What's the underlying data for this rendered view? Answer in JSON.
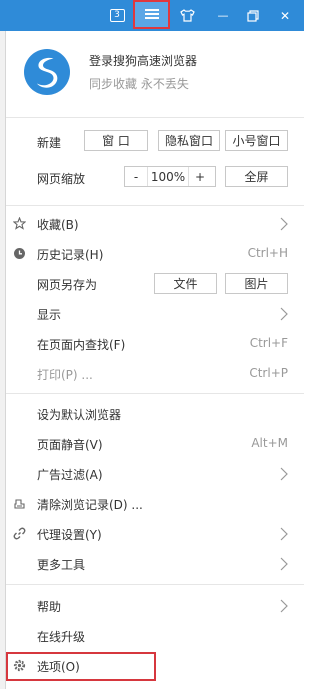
{
  "titlebar": {
    "tab_count": "3",
    "menu_icon": "hamburger-menu-icon",
    "skin_icon": "tshirt-skin-icon",
    "minimize_glyph": "—",
    "restore_icon": "restore-window-icon",
    "close_glyph": "✕",
    "bg_color": "#2f8bd8",
    "highlight_color": "#e0383e"
  },
  "profile": {
    "title": "登录搜狗高速浏览器",
    "subtitle": "同步收藏 永不丢失",
    "logo_icon": "sogou-logo-icon"
  },
  "new_row": {
    "label": "新建",
    "buttons": [
      "窗 口",
      "隐私窗口",
      "小号窗口"
    ]
  },
  "zoom_row": {
    "label": "网页缩放",
    "minus": "-",
    "value": "100%",
    "plus": "+",
    "fullscreen": "全屏"
  },
  "menu": {
    "favorites": {
      "label": "收藏(B)",
      "icon": "star-icon"
    },
    "history": {
      "label": "历史记录(H)",
      "shortcut": "Ctrl+H",
      "icon": "clock-icon"
    },
    "save_as": {
      "label": "网页另存为",
      "btn_file": "文件",
      "btn_image": "图片"
    },
    "display": {
      "label": "显示"
    },
    "find": {
      "label": "在页面内查找(F)",
      "shortcut": "Ctrl+F"
    },
    "print": {
      "label": "打印(P) ...",
      "shortcut": "Ctrl+P"
    },
    "set_default": {
      "label": "设为默认浏览器"
    },
    "mute": {
      "label": "页面静音(V)",
      "shortcut": "Alt+M"
    },
    "ad_filter": {
      "label": "广告过滤(A)"
    },
    "clear_history": {
      "label": "清除浏览记录(D) ...",
      "icon": "eraser-icon"
    },
    "proxy": {
      "label": "代理设置(Y)",
      "icon": "link-icon"
    },
    "more_tools": {
      "label": "更多工具"
    },
    "help": {
      "label": "帮助"
    },
    "update": {
      "label": "在线升级"
    },
    "options": {
      "label": "选项(O)",
      "icon": "gear-icon"
    }
  }
}
